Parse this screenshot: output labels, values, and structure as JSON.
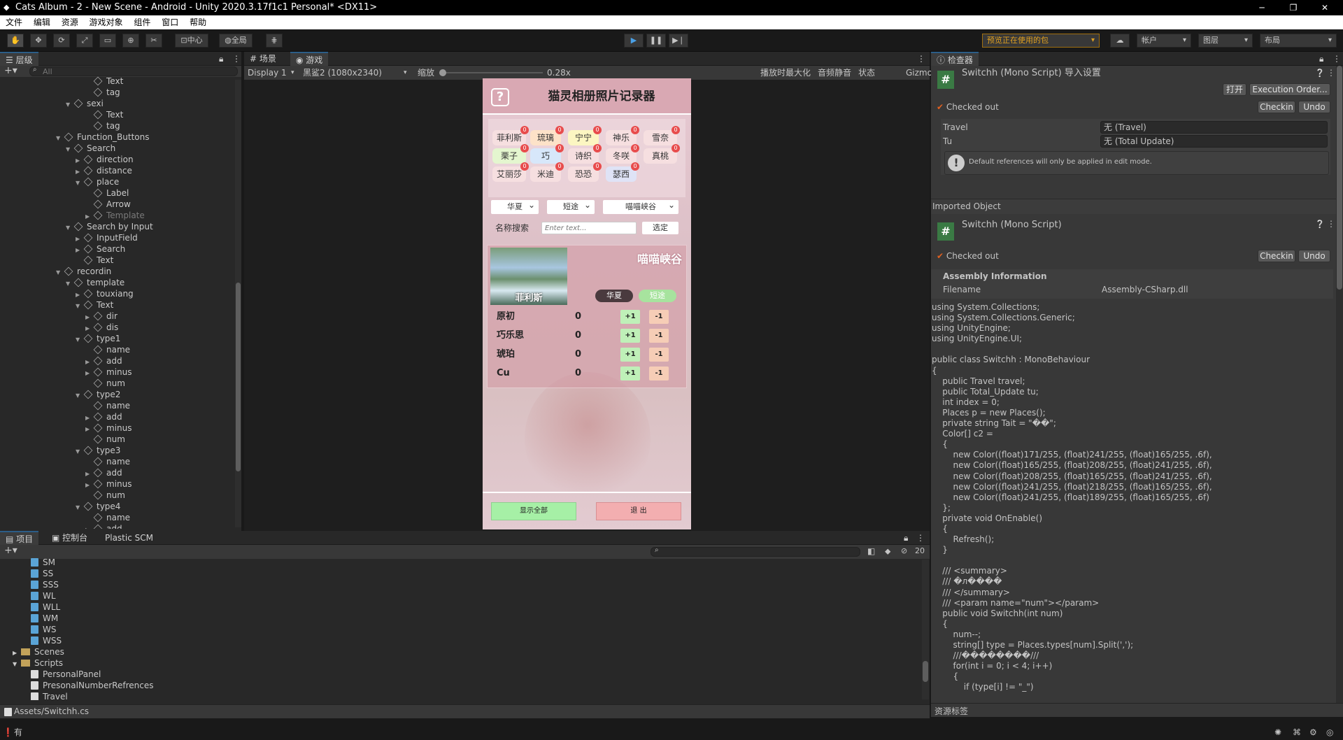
{
  "window": {
    "title": "Cats Album - 2 - New Scene - Android - Unity 2020.3.17f1c1 Personal* <DX11>"
  },
  "menu": [
    "文件",
    "编辑",
    "资源",
    "游戏对象",
    "组件",
    "窗口",
    "帮助"
  ],
  "toolbar": {
    "pivot_label": "中心",
    "global_label": "全局",
    "package_dropdown": "预览正在使用的包",
    "account_label": "帐户",
    "layers_label": "图层",
    "layout_label": "布局"
  },
  "hierarchy": {
    "tab_label": "层级",
    "search_placeholder": "All",
    "items": [
      {
        "label": "Text",
        "indent": 9,
        "arrow": ""
      },
      {
        "label": "tag",
        "indent": 9,
        "arrow": ""
      },
      {
        "label": "sexi",
        "indent": 7,
        "arrow": "▼"
      },
      {
        "label": "Text",
        "indent": 9,
        "arrow": ""
      },
      {
        "label": "tag",
        "indent": 9,
        "arrow": ""
      },
      {
        "label": "Function_Buttons",
        "indent": 6,
        "arrow": "▼"
      },
      {
        "label": "Search",
        "indent": 7,
        "arrow": "▼"
      },
      {
        "label": "direction",
        "indent": 8,
        "arrow": "▶"
      },
      {
        "label": "distance",
        "indent": 8,
        "arrow": "▶"
      },
      {
        "label": "place",
        "indent": 8,
        "arrow": "▼"
      },
      {
        "label": "Label",
        "indent": 9,
        "arrow": ""
      },
      {
        "label": "Arrow",
        "indent": 9,
        "arrow": ""
      },
      {
        "label": "Template",
        "indent": 9,
        "arrow": "▶",
        "dim": true
      },
      {
        "label": "Search by Input",
        "indent": 7,
        "arrow": "▼"
      },
      {
        "label": "InputField",
        "indent": 8,
        "arrow": "▶"
      },
      {
        "label": "Search",
        "indent": 8,
        "arrow": "▶"
      },
      {
        "label": "Text",
        "indent": 8,
        "arrow": ""
      },
      {
        "label": "recordin",
        "indent": 6,
        "arrow": "▼"
      },
      {
        "label": "template",
        "indent": 7,
        "arrow": "▼"
      },
      {
        "label": "touxiang",
        "indent": 8,
        "arrow": "▶"
      },
      {
        "label": "Text",
        "indent": 8,
        "arrow": "▼"
      },
      {
        "label": "dir",
        "indent": 9,
        "arrow": "▶"
      },
      {
        "label": "dis",
        "indent": 9,
        "arrow": "▶"
      },
      {
        "label": "type1",
        "indent": 8,
        "arrow": "▼"
      },
      {
        "label": "name",
        "indent": 9,
        "arrow": ""
      },
      {
        "label": "add",
        "indent": 9,
        "arrow": "▶"
      },
      {
        "label": "minus",
        "indent": 9,
        "arrow": "▶"
      },
      {
        "label": "num",
        "indent": 9,
        "arrow": ""
      },
      {
        "label": "type2",
        "indent": 8,
        "arrow": "▼"
      },
      {
        "label": "name",
        "indent": 9,
        "arrow": ""
      },
      {
        "label": "add",
        "indent": 9,
        "arrow": "▶"
      },
      {
        "label": "minus",
        "indent": 9,
        "arrow": "▶"
      },
      {
        "label": "num",
        "indent": 9,
        "arrow": ""
      },
      {
        "label": "type3",
        "indent": 8,
        "arrow": "▼"
      },
      {
        "label": "name",
        "indent": 9,
        "arrow": ""
      },
      {
        "label": "add",
        "indent": 9,
        "arrow": "▶"
      },
      {
        "label": "minus",
        "indent": 9,
        "arrow": "▶"
      },
      {
        "label": "num",
        "indent": 9,
        "arrow": ""
      },
      {
        "label": "type4",
        "indent": 8,
        "arrow": "▼"
      },
      {
        "label": "name",
        "indent": 9,
        "arrow": ""
      },
      {
        "label": "add",
        "indent": 9,
        "arrow": "▶"
      }
    ]
  },
  "scene_tabs": {
    "scene": "场景",
    "game": "游戏"
  },
  "game_bar": {
    "display": "Display 1",
    "resolution": "黑鲨2 (1080x2340)",
    "scale_label": "缩放",
    "scale_value": "0.28x",
    "maximize": "播放时最大化",
    "mute": "音频静音",
    "stats": "状态",
    "gizmos": "Gizmos"
  },
  "app": {
    "help_icon": "?",
    "title": "猫灵相册照片记录器",
    "chips": [
      {
        "label": "菲利斯",
        "color": "#f6dfe0",
        "badge": "0"
      },
      {
        "label": "琉璃",
        "color": "#fde2c8",
        "badge": "0"
      },
      {
        "label": "宁宁",
        "color": "#fcf6c2",
        "badge": "0"
      },
      {
        "label": "神乐",
        "color": "#f6dfe0",
        "badge": "0"
      },
      {
        "label": "雪奈",
        "color": "#f6dfe0",
        "badge": "0"
      },
      {
        "label": "栗子",
        "color": "#e4f6cf",
        "badge": "0"
      },
      {
        "label": "巧",
        "color": "#d7e7fa",
        "badge": "0"
      },
      {
        "label": "诗织",
        "color": "#f6dfe0",
        "badge": "0"
      },
      {
        "label": "冬咲",
        "color": "#f6dfe0",
        "badge": "0"
      },
      {
        "label": "真桃",
        "color": "#f6dfe0",
        "badge": "0"
      },
      {
        "label": "艾丽莎",
        "color": "#f6dfe0",
        "badge": "0"
      },
      {
        "label": "米迪",
        "color": "#f6dfe0",
        "badge": "0"
      },
      {
        "label": "恐恐",
        "color": "#f6dfe0",
        "badge": "0"
      },
      {
        "label": "瑟西",
        "color": "#dfe3f6",
        "badge": "0"
      }
    ],
    "dropdowns": [
      "华夏",
      "短途",
      "喵喵峡谷"
    ],
    "search_label": "名称搜索",
    "search_placeholder": "Enter text...",
    "search_button": "选定",
    "card": {
      "place": "喵喵峡谷",
      "name": "菲利斯",
      "tag1": "华夏",
      "tag2": "短途",
      "rows": [
        {
          "name": "原初",
          "num": "0"
        },
        {
          "name": "巧乐思",
          "num": "0"
        },
        {
          "name": "琥珀",
          "num": "0"
        },
        {
          "name": "Cu",
          "num": "0"
        }
      ],
      "plus": "+1",
      "minus": "-1"
    },
    "show_all": "显示全部",
    "exit": "退 出"
  },
  "inspector": {
    "tab_label": "检查器",
    "header1": "Switchh (Mono Script) 导入设置",
    "open_btn": "打开",
    "exec_btn": "Execution Order...",
    "checked_out": "Checked out",
    "checkin": "Checkin",
    "undo": "Undo",
    "fields": [
      {
        "label": "Travel",
        "value": "无 (Travel)"
      },
      {
        "label": "Tu",
        "value": "无 (Total Update)"
      }
    ],
    "info_msg": "Default references will only be applied in edit mode.",
    "imported_object": "Imported Object",
    "header2": "Switchh (Mono Script)",
    "assembly_info": "Assembly Information",
    "filename_label": "Filename",
    "filename_value": "Assembly-CSharp.dll",
    "code": "using System.Collections;\nusing System.Collections.Generic;\nusing UnityEngine;\nusing UnityEngine.UI;\n\npublic class Switchh : MonoBehaviour\n{\n    public Travel travel;\n    public Total_Update tu;\n    int index = 0;\n    Places p = new Places();\n    private string Tait = \"��\";\n    Color[] c2 =\n    {\n        new Color((float)171/255, (float)241/255, (float)165/255, .6f),\n        new Color((float)165/255, (float)208/255, (float)241/255, .6f),\n        new Color((float)208/255, (float)165/255, (float)241/255, .6f),\n        new Color((float)241/255, (float)218/255, (float)165/255, .6f),\n        new Color((float)241/255, (float)189/255, (float)165/255, .6f)\n    };\n    private void OnEnable()\n    {\n        Refresh();\n    }\n\n    /// <summary>\n    /// �л����\n    /// </summary>\n    /// <param name=\"num\"></param>\n    public void Switchh(int num)\n    {\n        num--;\n        string[] type = Places.types[num].Split(',');\n        ///��������///\n        for(int i = 0; i < 4; i++)\n        {\n            if (type[i] != \"_\")",
    "asset_labels": "资源标签"
  },
  "project": {
    "tabs": [
      "项目",
      "控制台",
      "Plastic SCM"
    ],
    "count": "20",
    "items": [
      {
        "label": "SM",
        "indent": 2,
        "kind": "cs"
      },
      {
        "label": "SS",
        "indent": 2,
        "kind": "cs"
      },
      {
        "label": "SSS",
        "indent": 2,
        "kind": "cs"
      },
      {
        "label": "WL",
        "indent": 2,
        "kind": "cs"
      },
      {
        "label": "WLL",
        "indent": 2,
        "kind": "cs"
      },
      {
        "label": "WM",
        "indent": 2,
        "kind": "cs"
      },
      {
        "label": "WS",
        "indent": 2,
        "kind": "cs"
      },
      {
        "label": "WSS",
        "indent": 2,
        "kind": "cs"
      },
      {
        "label": "Scenes",
        "indent": 1,
        "kind": "folder",
        "arrow": "▶"
      },
      {
        "label": "Scripts",
        "indent": 1,
        "kind": "folder",
        "arrow": "▼"
      },
      {
        "label": "PersonalPanel",
        "indent": 2,
        "kind": "script"
      },
      {
        "label": "PresonalNumberRefrences",
        "indent": 2,
        "kind": "script"
      },
      {
        "label": "Travel",
        "indent": 2,
        "kind": "script"
      }
    ],
    "path": "Assets/Switchh.cs"
  },
  "status": {
    "text": "有"
  }
}
